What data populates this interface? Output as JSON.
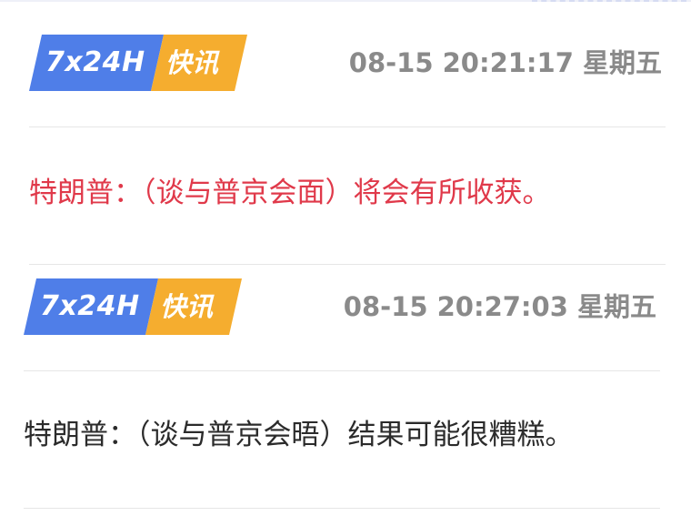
{
  "news": [
    {
      "badge_left": "7x24H",
      "badge_right": "快讯",
      "timestamp": "08-15 20:21:17 星期五",
      "headline": "特朗普：（谈与普京会面）将会有所收获。",
      "headline_color": "#e0394a"
    },
    {
      "badge_left": "7x24H",
      "badge_right": "快讯",
      "timestamp": "08-15 20:27:03 星期五",
      "headline": "特朗普：（谈与普京会晤）结果可能很糟糕。",
      "headline_color": "#2b2b2b"
    }
  ],
  "colors": {
    "badge_blue": "#4f7ee8",
    "badge_orange": "#f5ad2f",
    "timestamp": "#8a8a8a",
    "divider": "#e6e6e6"
  }
}
